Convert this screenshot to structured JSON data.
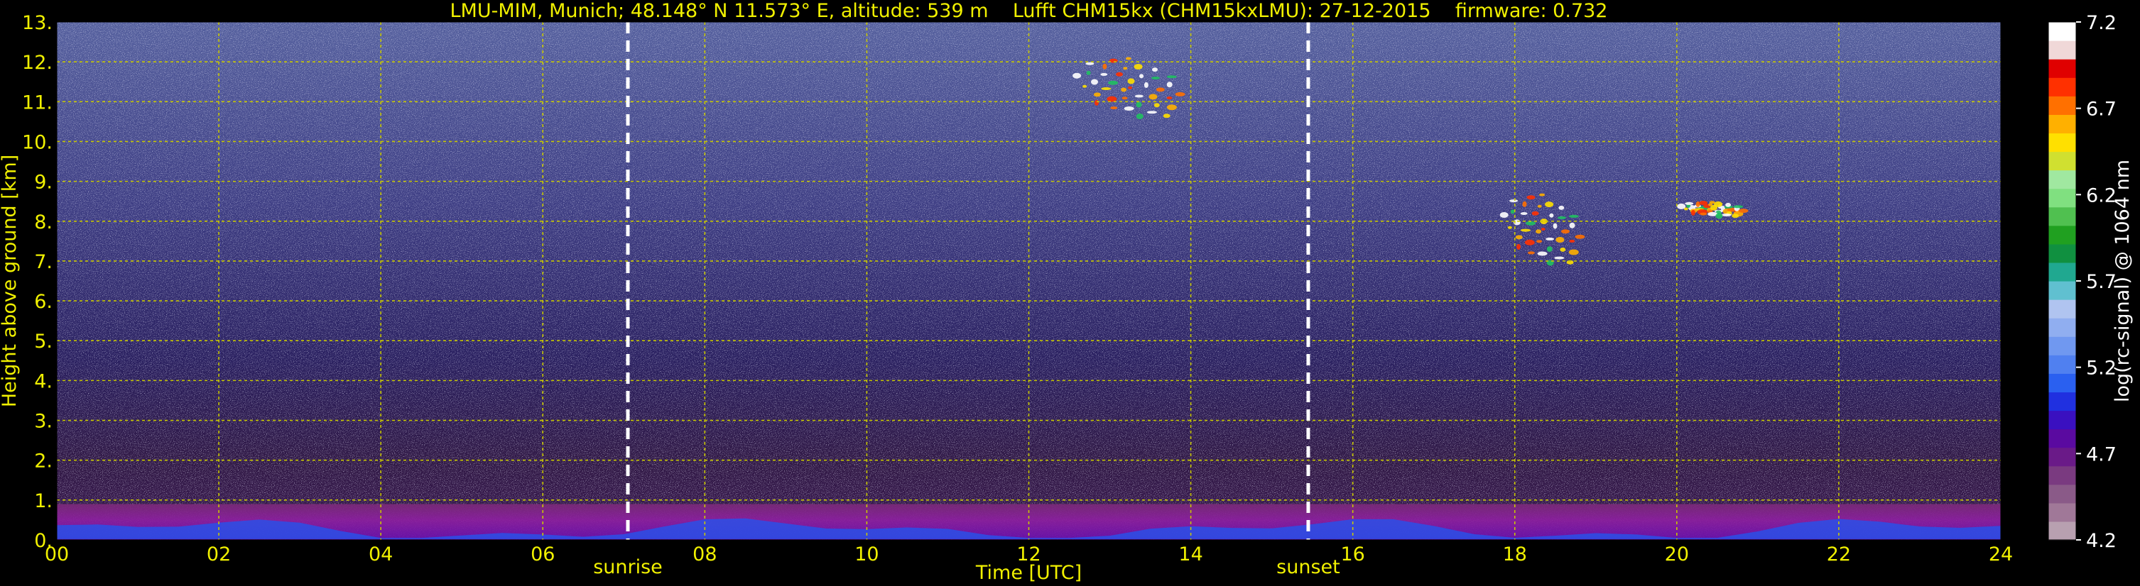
{
  "chart_data": {
    "type": "heatmap",
    "title": "LMU-MIM, Munich; 48.148° N 11.573° E, altitude: 539 m    Lufft CHM15kx (CHM15kxLMU): 27-12-2015    firmware: 0.732",
    "xlabel": "Time [UTC]",
    "ylabel": "Height above ground [km]",
    "x_range": [
      0,
      24
    ],
    "y_range": [
      0,
      13
    ],
    "x_ticks": [
      "00",
      "02",
      "04",
      "06",
      "08",
      "10",
      "12",
      "14",
      "16",
      "18",
      "20",
      "22",
      "24"
    ],
    "x_tick_values": [
      0,
      2,
      4,
      6,
      8,
      10,
      12,
      14,
      16,
      18,
      20,
      22,
      24
    ],
    "y_ticks": [
      "0.",
      "1.",
      "2.",
      "3.",
      "4.",
      "5.",
      "6.",
      "7.",
      "8.",
      "9.",
      "10.",
      "11.",
      "12.",
      "13."
    ],
    "y_tick_values": [
      0,
      1,
      2,
      3,
      4,
      5,
      6,
      7,
      8,
      9,
      10,
      11,
      12,
      13
    ],
    "grid": true,
    "markers": [
      {
        "label": "sunrise",
        "x": 7.05
      },
      {
        "label": "sunset",
        "x": 15.45
      }
    ],
    "colorbar": {
      "label": "log(rc-signal) @ 1064 nm",
      "range": [
        4.2,
        7.2
      ],
      "ticks": [
        "4.2",
        "4.7",
        "5.2",
        "5.7",
        "6.2",
        "6.7",
        "7.2"
      ],
      "tick_values": [
        4.2,
        4.7,
        5.2,
        5.7,
        6.2,
        6.7,
        7.2
      ],
      "colors": [
        "#b8a0b0",
        "#a07898",
        "#8a5a88",
        "#7a3a80",
        "#6a1a88",
        "#5a0aa0",
        "#3a10c0",
        "#2030e0",
        "#2a60f0",
        "#5080f0",
        "#7098f0",
        "#90aef0",
        "#b0c4f0",
        "#60c0d0",
        "#20a890",
        "#109040",
        "#20a020",
        "#50c050",
        "#80e080",
        "#a0e8a0",
        "#d0e030",
        "#ffe000",
        "#ffb000",
        "#ff7000",
        "#ff3000",
        "#e00000",
        "#f0d8d8",
        "#ffffff"
      ]
    },
    "features": [
      {
        "label": "boundary layer",
        "x": [
          0,
          24
        ],
        "y": [
          0,
          0.9
        ]
      },
      {
        "label": "cirrus clouds",
        "x": [
          12.5,
          14.0
        ],
        "y": [
          10.5,
          12.2
        ]
      },
      {
        "label": "cirrus clouds",
        "x": [
          17.8,
          18.9
        ],
        "y": [
          6.8,
          8.8
        ]
      },
      {
        "label": "cirrus clouds",
        "x": [
          20.0,
          20.9
        ],
        "y": [
          8.1,
          8.5
        ]
      }
    ]
  },
  "colors": {
    "label_color": "#f0f000",
    "grid_color": "#c8c800",
    "marker_color": "#ffffff",
    "colorbar_text": "#ffffff",
    "background": "#000000"
  }
}
